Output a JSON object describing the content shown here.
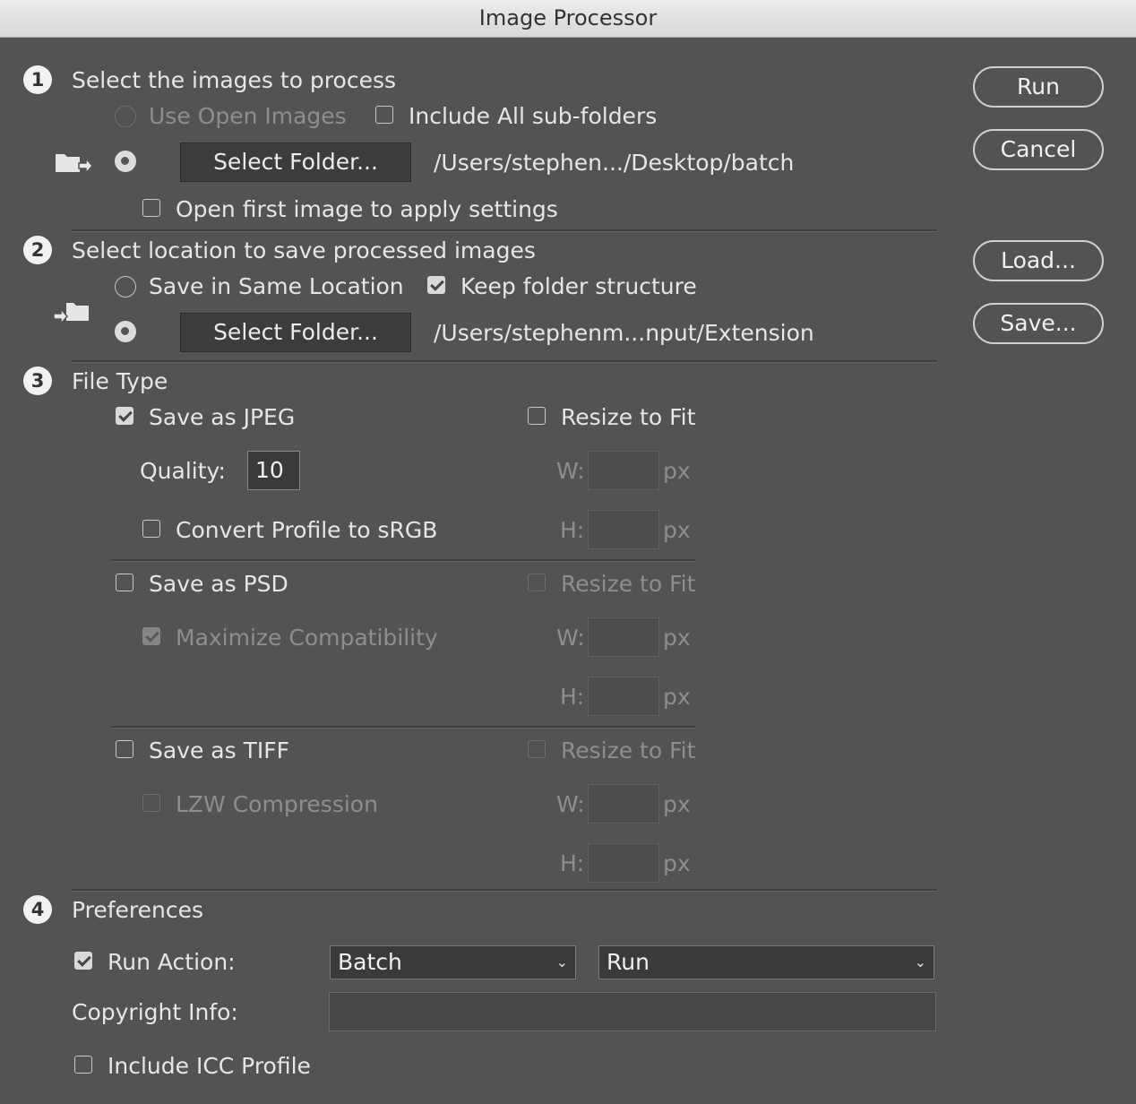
{
  "window": {
    "title": "Image Processor"
  },
  "step1": {
    "number": "1",
    "heading": "Select the images to process",
    "use_open_images": "Use Open Images",
    "include_subfolders": "Include All sub-folders",
    "select_folder_label": "Select Folder...",
    "folder_path": "/Users/stephen.../Desktop/batch",
    "open_first_image": "Open first image to apply settings"
  },
  "step2": {
    "number": "2",
    "heading": "Select location to save processed images",
    "save_same_location": "Save in Same Location",
    "keep_folder_structure": "Keep folder structure",
    "select_folder_label": "Select Folder...",
    "folder_path": "/Users/stephenm...nput/Extension"
  },
  "step3": {
    "number": "3",
    "heading": "File Type",
    "jpeg": {
      "save_label": "Save as JPEG",
      "resize_label": "Resize to Fit",
      "quality_label": "Quality:",
      "quality_value": "10",
      "convert_label": "Convert Profile to sRGB",
      "w_label": "W:",
      "h_label": "H:",
      "unit": "px"
    },
    "psd": {
      "save_label": "Save as PSD",
      "resize_label": "Resize to Fit",
      "maximize_label": "Maximize Compatibility",
      "w_label": "W:",
      "h_label": "H:",
      "unit": "px"
    },
    "tiff": {
      "save_label": "Save as TIFF",
      "resize_label": "Resize to Fit",
      "lzw_label": "LZW Compression",
      "w_label": "W:",
      "h_label": "H:",
      "unit": "px"
    }
  },
  "step4": {
    "number": "4",
    "heading": "Preferences",
    "run_action_label": "Run Action:",
    "action_set": "Batch",
    "action": "Run",
    "copyright_label": "Copyright Info:",
    "copyright_value": "",
    "icc_label": "Include ICC Profile"
  },
  "buttons": {
    "run": "Run",
    "cancel": "Cancel",
    "load": "Load...",
    "save": "Save..."
  }
}
